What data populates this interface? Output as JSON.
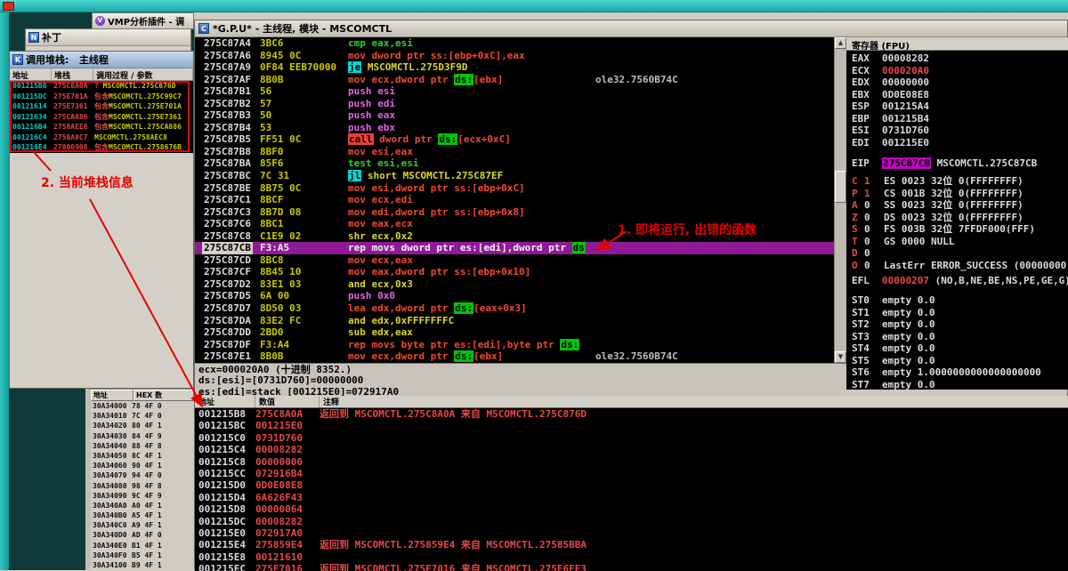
{
  "vmp": {
    "title": "VMP分析插件 - 调",
    "icon": "V"
  },
  "patch": {
    "title": "补丁",
    "icon": "N"
  },
  "callstack": {
    "title": "调用堆栈:   主线程",
    "icon": "K",
    "columns": [
      "地址",
      "堆栈",
      "调用过程 / 参数"
    ],
    "rows": [
      {
        "addr": "001215B8",
        "stack": "275C8A0A",
        "prefix": "? ",
        "proc": "MSCOMCTL.275C876D"
      },
      {
        "addr": "001215DC",
        "stack": "275E701A",
        "prefix": "包含",
        "proc": "MSCOMCTL.275C99C7"
      },
      {
        "addr": "00121614",
        "stack": "275E7361",
        "prefix": "包含",
        "proc": "MSCOMCTL.275E701A"
      },
      {
        "addr": "00121634",
        "stack": "275CA886",
        "prefix": "包含",
        "proc": "MSCOMCTL.275E7361"
      },
      {
        "addr": "001216B4",
        "stack": "2758AEE8",
        "prefix": "包含",
        "proc": "MSCOMCTL.275CA886"
      },
      {
        "addr": "001216C4",
        "stack": "2758A8C7",
        "prefix": "",
        "proc": "MSCOMCTL.2758AEC8"
      },
      {
        "addr": "001216E4",
        "stack": "27800908",
        "prefix": "包含",
        "proc": "MSCOMCTL.2758676B"
      }
    ]
  },
  "dump": {
    "columns": [
      "地址",
      "HEX 数"
    ],
    "rows": [
      [
        "30A34000",
        "78 4F 0"
      ],
      [
        "30A34010",
        "7C 4F 0"
      ],
      [
        "30A34020",
        "80 4F 1"
      ],
      [
        "30A34030",
        "84 4F 9"
      ],
      [
        "30A34040",
        "88 4F 8"
      ],
      [
        "30A34050",
        "8C 4F 1"
      ],
      [
        "30A34060",
        "90 4F 1"
      ],
      [
        "30A34070",
        "94 4F 0"
      ],
      [
        "30A34080",
        "98 4F 8"
      ],
      [
        "30A34090",
        "9C 4F 9"
      ],
      [
        "30A340A0",
        "A0 4F 1"
      ],
      [
        "30A340B0",
        "A5 4F 1"
      ],
      [
        "30A340C0",
        "A9 4F 1"
      ],
      [
        "30A340D0",
        "AD 4F 0"
      ],
      [
        "30A340E0",
        "B1 4F 1"
      ],
      [
        "30A340F0",
        "B5 4F 1"
      ],
      [
        "30A34100",
        "B9 4F 1"
      ]
    ]
  },
  "cpu": {
    "title": "*G.P.U* - 主线程, 模块 - MSCOMCTL",
    "icon": "C",
    "info": [
      "ecx=000020A0 (十进制 8352.)",
      "ds:[esi]=[0731D760]=00000000",
      "es:[edi]=stack [001215E0]=072917A0"
    ],
    "disasm": [
      {
        "addr": "275C87A4",
        "bytes": "3BC6",
        "tokens": [
          [
            "cmp eax,esi",
            "green"
          ]
        ]
      },
      {
        "addr": "275C87A6",
        "bytes": "8945 0C",
        "tokens": [
          [
            "mov dword ptr ss:[ebp+0xC],eax",
            "red"
          ]
        ]
      },
      {
        "addr": "275C87A9",
        "bytes": "0F84 EEB70000",
        "tokens": [
          [
            "je",
            "chip-cyan"
          ],
          [
            " ",
            "plain"
          ],
          [
            "MSCOMCTL.275D3F9D",
            "yel"
          ]
        ]
      },
      {
        "addr": "275C87AF",
        "bytes": "8B0B",
        "tokens": [
          [
            "mov ecx,dword ptr ",
            "red"
          ],
          [
            "ds:",
            "chip-green"
          ],
          [
            "[ebx]",
            "red"
          ]
        ],
        "comment": "ole32.7560B74C"
      },
      {
        "addr": "275C87B1",
        "bytes": "56",
        "tokens": [
          [
            "push esi",
            "mag"
          ]
        ]
      },
      {
        "addr": "275C87B2",
        "bytes": "57",
        "tokens": [
          [
            "push edi",
            "mag"
          ]
        ]
      },
      {
        "addr": "275C87B3",
        "bytes": "50",
        "tokens": [
          [
            "push eax",
            "mag"
          ]
        ]
      },
      {
        "addr": "275C87B4",
        "bytes": "53",
        "tokens": [
          [
            "push ebx",
            "mag"
          ]
        ]
      },
      {
        "addr": "275C87B5",
        "bytes": "FF51 0C",
        "tokens": [
          [
            "call",
            "chip-red"
          ],
          [
            " dword ptr ",
            "red"
          ],
          [
            "ds:",
            "chip-green"
          ],
          [
            "[ecx+0xC]",
            "red"
          ]
        ]
      },
      {
        "addr": "275C87B8",
        "bytes": "8BF0",
        "tokens": [
          [
            "mov esi,eax",
            "red"
          ]
        ]
      },
      {
        "addr": "275C87BA",
        "bytes": "85F6",
        "tokens": [
          [
            "test esi,esi",
            "green"
          ]
        ]
      },
      {
        "addr": "275C87BC",
        "bytes": "7C 31",
        "tokens": [
          [
            "jl",
            "chip-cyan"
          ],
          [
            " ",
            "plain"
          ],
          [
            "short MSCOMCTL.275C87EF",
            "yel"
          ]
        ]
      },
      {
        "addr": "275C87BE",
        "bytes": "8B75 0C",
        "tokens": [
          [
            "mov esi,dword ptr ss:[ebp+0xC]",
            "red"
          ]
        ]
      },
      {
        "addr": "275C87C1",
        "bytes": "8BCF",
        "tokens": [
          [
            "mov ecx,edi",
            "red"
          ]
        ]
      },
      {
        "addr": "275C87C3",
        "bytes": "8B7D 08",
        "tokens": [
          [
            "mov edi,dword ptr ss:[ebp+0x8]",
            "red"
          ]
        ]
      },
      {
        "addr": "275C87C6",
        "bytes": "8BC1",
        "tokens": [
          [
            "mov eax,ecx",
            "red"
          ]
        ]
      },
      {
        "addr": "275C87C8",
        "bytes": "C1E9 02",
        "tokens": [
          [
            "shr ecx,0x2",
            "yel"
          ]
        ]
      },
      {
        "addr": "275C87CB",
        "bytes": "F3:A5",
        "selected": true,
        "tokens": [
          [
            "rep movs dword ptr es:[edi],dword ptr ",
            "sel"
          ],
          [
            "ds",
            "chip-green"
          ]
        ]
      },
      {
        "addr": "275C87CD",
        "bytes": "8BC8",
        "tokens": [
          [
            "mov ecx,eax",
            "red"
          ]
        ]
      },
      {
        "addr": "275C87CF",
        "bytes": "8B45 10",
        "tokens": [
          [
            "mov eax,dword ptr ss:[ebp+0x10]",
            "red"
          ]
        ]
      },
      {
        "addr": "275C87D2",
        "bytes": "83E1 03",
        "tokens": [
          [
            "and ecx,0x3",
            "yel"
          ]
        ]
      },
      {
        "addr": "275C87D5",
        "bytes": "6A 00",
        "tokens": [
          [
            "push 0x0",
            "mag"
          ]
        ]
      },
      {
        "addr": "275C87D7",
        "bytes": "8D50 03",
        "tokens": [
          [
            "lea edx,dword ptr ",
            "red"
          ],
          [
            "ds:",
            "chip-green"
          ],
          [
            "[eax+0x3]",
            "red"
          ]
        ]
      },
      {
        "addr": "275C87DA",
        "bytes": "83E2 FC",
        "tokens": [
          [
            "and edx,0xFFFFFFFC",
            "yel"
          ]
        ]
      },
      {
        "addr": "275C87DD",
        "bytes": "2BD0",
        "tokens": [
          [
            "sub edx,eax",
            "yel"
          ]
        ]
      },
      {
        "addr": "275C87DF",
        "bytes": "F3:A4",
        "tokens": [
          [
            "rep movs byte ptr es:[edi],byte ptr ",
            "red"
          ],
          [
            "ds:",
            "chip-green"
          ]
        ]
      },
      {
        "addr": "275C87E1",
        "bytes": "8B0B",
        "tokens": [
          [
            "mov ecx,dword ptr ",
            "red"
          ],
          [
            "ds:",
            "chip-green"
          ],
          [
            "[ebx]",
            "red"
          ]
        ],
        "comment": "ole32.7560B74C"
      }
    ]
  },
  "registers": {
    "title": "寄存器 (FPU)",
    "gpr": [
      {
        "name": "EAX",
        "value": "00008282",
        "red": false
      },
      {
        "name": "ECX",
        "value": "000020A0",
        "red": true
      },
      {
        "name": "EDX",
        "value": "00000000",
        "red": false
      },
      {
        "name": "EBX",
        "value": "0D0E08E8",
        "red": false
      },
      {
        "name": "ESP",
        "value": "001215A4",
        "red": false
      },
      {
        "name": "EBP",
        "value": "001215B4",
        "red": false
      },
      {
        "name": "ESI",
        "value": "0731D760",
        "red": false
      },
      {
        "name": "EDI",
        "value": "001215E0",
        "red": false
      }
    ],
    "eip": {
      "name": "EIP",
      "value": "275C87CB",
      "module": "MSCOMCTL.275C87CB"
    },
    "flags": [
      {
        "f": "C",
        "v": "1",
        "red": true,
        "rest": "ES 0023 32位 0(FFFFFFFF)"
      },
      {
        "f": "P",
        "v": "1",
        "red": true,
        "rest": "CS 001B 32位 0(FFFFFFFF)"
      },
      {
        "f": "A",
        "v": "0",
        "red": false,
        "rest": "SS 0023 32位 0(FFFFFFFF)"
      },
      {
        "f": "Z",
        "v": "0",
        "red": false,
        "rest": "DS 0023 32位 0(FFFFFFFF)"
      },
      {
        "f": "S",
        "v": "0",
        "red": false,
        "rest": "FS 003B 32位 7FFDF000(FFF)"
      },
      {
        "f": "T",
        "v": "0",
        "red": false,
        "rest": "GS 0000 NULL"
      },
      {
        "f": "D",
        "v": "0",
        "red": false,
        "rest": ""
      },
      {
        "f": "O",
        "v": "0",
        "red": false,
        "rest": "LastErr ERROR_SUCCESS (00000000"
      }
    ],
    "efl": {
      "label": "EFL",
      "value": "00000207",
      "rest": "(NO,B,NE,BE,NS,PE,GE,G)"
    },
    "fpu": [
      {
        "name": "ST0",
        "text": "empty 0.0"
      },
      {
        "name": "ST1",
        "text": "empty 0.0"
      },
      {
        "name": "ST2",
        "text": "empty 0.0"
      },
      {
        "name": "ST3",
        "text": "empty 0.0"
      },
      {
        "name": "ST4",
        "text": "empty 0.0"
      },
      {
        "name": "ST5",
        "text": "empty 0.0"
      },
      {
        "name": "ST6",
        "text": "empty 1.0000000000000000000"
      },
      {
        "name": "ST7",
        "text": "empty 0.0"
      }
    ]
  },
  "stack": {
    "columns": [
      "地址",
      "数值",
      "注释"
    ],
    "rows": [
      {
        "addr": "001215B8",
        "value": "275C8A0A",
        "comment": "返回到 MSCOMCTL.275C8A0A 来自 MSCOMCTL.275C876D"
      },
      {
        "addr": "001215BC",
        "value": "001215E0",
        "comment": ""
      },
      {
        "addr": "001215C0",
        "value": "0731D760",
        "comment": ""
      },
      {
        "addr": "001215C4",
        "value": "00008282",
        "comment": ""
      },
      {
        "addr": "001215C8",
        "value": "00000000",
        "comment": ""
      },
      {
        "addr": "001215CC",
        "value": "072916B4",
        "comment": ""
      },
      {
        "addr": "001215D0",
        "value": "0D0E08E8",
        "comment": ""
      },
      {
        "addr": "001215D4",
        "value": "6A626F43",
        "comment": ""
      },
      {
        "addr": "001215D8",
        "value": "00000064",
        "comment": ""
      },
      {
        "addr": "001215DC",
        "value": "00008282",
        "comment": ""
      },
      {
        "addr": "001215E0",
        "value": "072917A0",
        "comment": ""
      },
      {
        "addr": "001215E4",
        "value": "275859E4",
        "comment": "返回到 MSCOMCTL.275859E4 来自 MSCOMCTL.27585BBA"
      },
      {
        "addr": "001215E8",
        "value": "00121610",
        "comment": ""
      },
      {
        "addr": "001215EC",
        "value": "275E7016",
        "comment": "返回到 MSCOMCTL.275E7016 来自 MSCOMCTL.275E6FE3"
      }
    ]
  },
  "annotations": {
    "note1": "1. 即将运行, 出错的函数",
    "note2": "2. 当前堆栈信息"
  }
}
